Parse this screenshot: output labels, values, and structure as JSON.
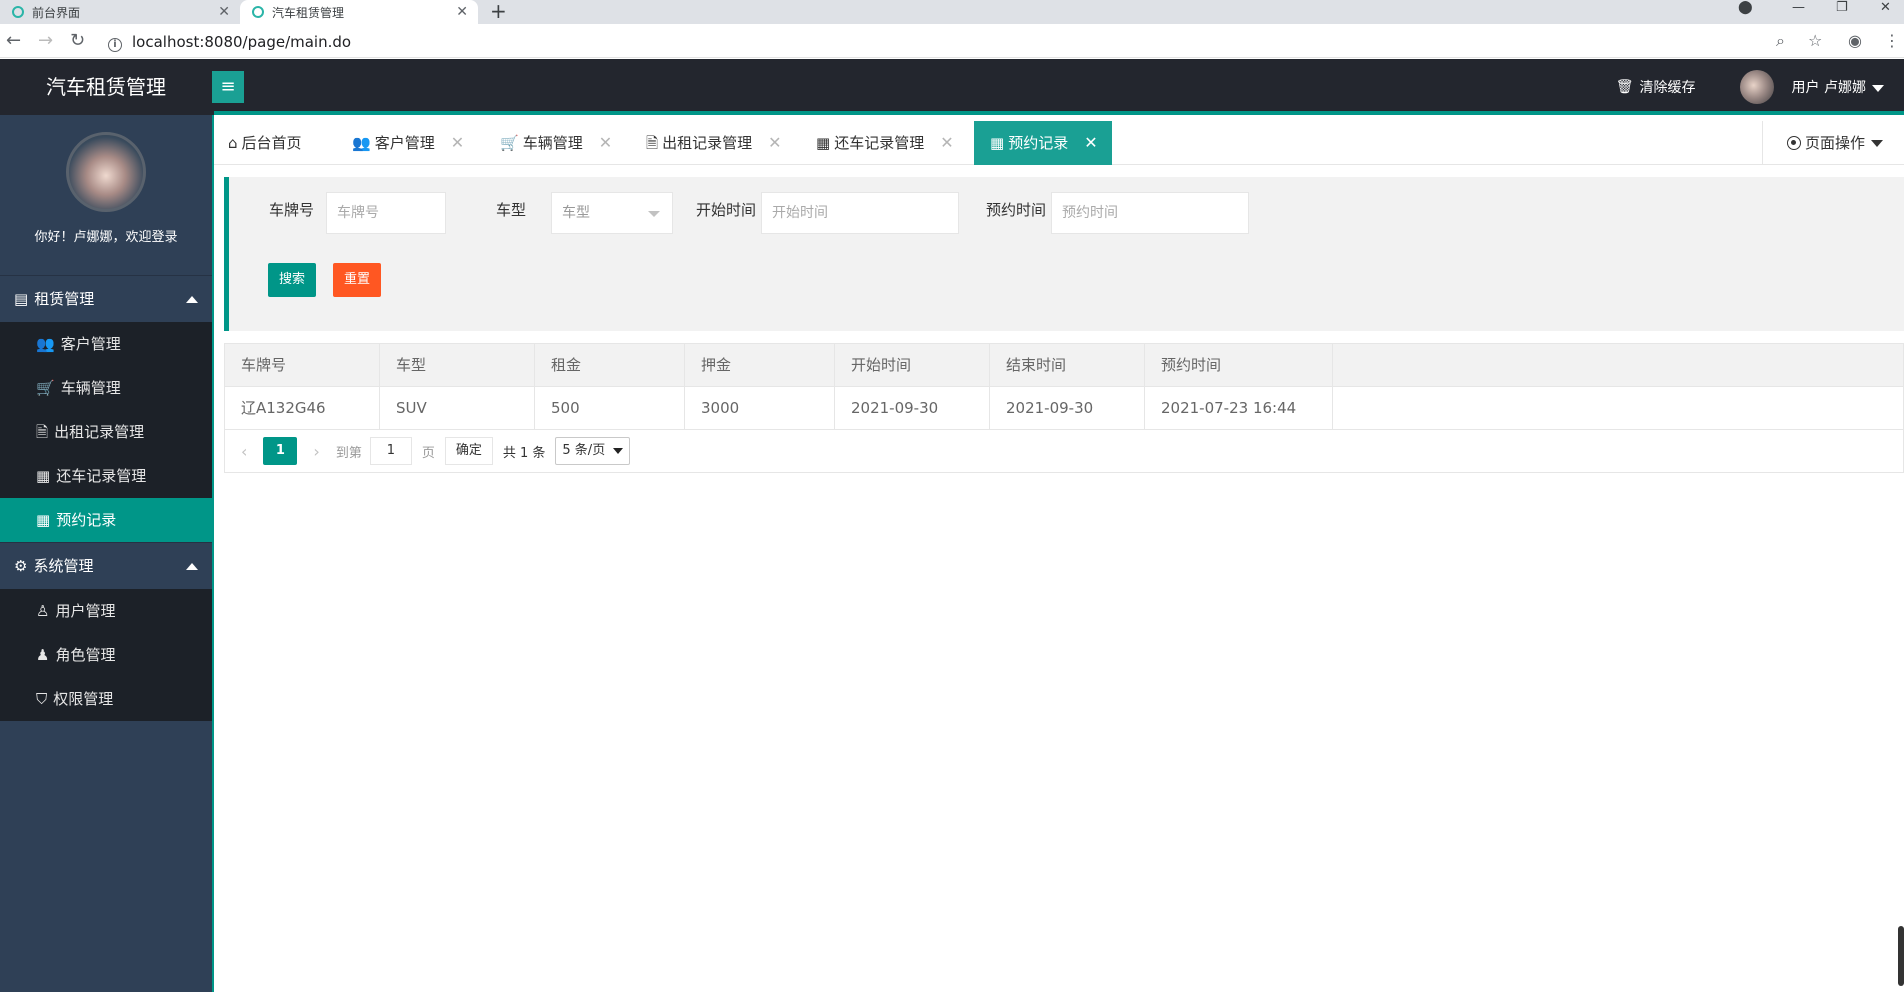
{
  "browser": {
    "tabs": [
      {
        "title": "前台界面",
        "close": "✕"
      },
      {
        "title": "汽车租赁管理",
        "close": "✕"
      }
    ],
    "new_tab": "+",
    "url": "localhost:8080/page/main.do",
    "info_icon": "i"
  },
  "header": {
    "title": "汽车租赁管理",
    "toggle_icon": "≡",
    "clear_cache": "清除缓存",
    "user_label": "用户  卢娜娜"
  },
  "sidebar": {
    "welcome": "你好！卢娜娜，欢迎登录",
    "groups": [
      {
        "label": "租赁管理",
        "items": [
          {
            "label": "客户管理",
            "icon": "users-icon"
          },
          {
            "label": "车辆管理",
            "icon": "cart-icon"
          },
          {
            "label": "出租记录管理",
            "icon": "file-icon"
          },
          {
            "label": "还车记录管理",
            "icon": "calendar-icon"
          },
          {
            "label": "预约记录",
            "icon": "calendar-icon",
            "active": true
          }
        ]
      },
      {
        "label": "系统管理",
        "items": [
          {
            "label": "用户管理",
            "icon": "user-icon"
          },
          {
            "label": "角色管理",
            "icon": "user-solid-icon"
          },
          {
            "label": "权限管理",
            "icon": "shield-icon"
          }
        ]
      }
    ]
  },
  "page_tabs": [
    {
      "label": "后台首页"
    },
    {
      "label": "客户管理"
    },
    {
      "label": "车辆管理"
    },
    {
      "label": "出租记录管理"
    },
    {
      "label": "还车记录管理"
    },
    {
      "label": "预约记录",
      "active": true
    }
  ],
  "tab_close": "✕",
  "page_ops": "页面操作",
  "search": {
    "plate_label": "车牌号",
    "plate_placeholder": "车牌号",
    "type_label": "车型",
    "type_value": "车型",
    "start_label": "开始时间",
    "start_placeholder": "开始时间",
    "reserve_label": "预约时间",
    "reserve_placeholder": "预约时间",
    "search_btn": "搜索",
    "reset_btn": "重置"
  },
  "table": {
    "headers": [
      "车牌号",
      "车型",
      "租金",
      "押金",
      "开始时间",
      "结束时间",
      "预约时间"
    ],
    "rows": [
      [
        "辽A132G46",
        "SUV",
        "500",
        "3000",
        "2021-09-30",
        "2021-09-30",
        "2021-07-23 16:44"
      ]
    ]
  },
  "pager": {
    "prev": "‹",
    "current": "1",
    "next": "›",
    "goto": "到第",
    "page_input": "1",
    "page_unit": "页",
    "ok": "确定",
    "total": "共 1 条",
    "limit": "5 条/页"
  },
  "colors": {
    "accent": "#009688",
    "reset": "#ff5722",
    "sidebar": "#2f4056",
    "header": "#23262e"
  }
}
